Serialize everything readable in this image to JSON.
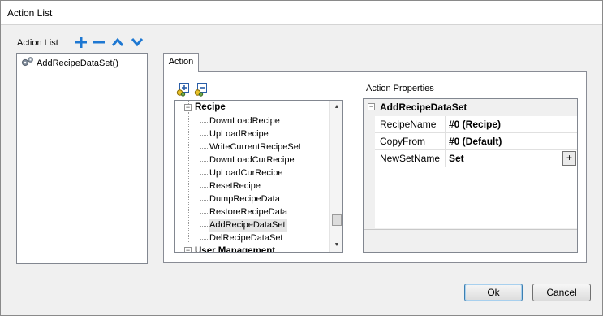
{
  "window": {
    "title": "Action List"
  },
  "action_list": {
    "label": "Action List",
    "toolbar": [
      {
        "name": "add-icon",
        "glyph": "+"
      },
      {
        "name": "remove-icon",
        "glyph": "−"
      },
      {
        "name": "move-up-icon",
        "glyph": "chevron-up"
      },
      {
        "name": "move-down-icon",
        "glyph": "chevron-down"
      }
    ],
    "items": [
      {
        "label": "AddRecipeDataSet()",
        "icon": "gear-icon"
      }
    ]
  },
  "tabs": [
    {
      "label": "Action",
      "active": true
    }
  ],
  "tree": {
    "groups": [
      {
        "label": "Recipe",
        "expanded": true,
        "items": [
          "DownLoadRecipe",
          "UpLoadRecipe",
          "WriteCurrentRecipeSet",
          "DownLoadCurRecipe",
          "UpLoadCurRecipe",
          "ResetRecipe",
          "DumpRecipeData",
          "RestoreRecipeData",
          "AddRecipeDataSet",
          "DelRecipeDataSet"
        ],
        "selected": "AddRecipeDataSet"
      },
      {
        "label": "User Management",
        "expanded": true
      }
    ],
    "expand_glyph": "−"
  },
  "properties": {
    "label": "Action Properties",
    "category": "AddRecipeDataSet",
    "rows": [
      {
        "name": "RecipeName",
        "value": "#0 (Recipe)"
      },
      {
        "name": "CopyFrom",
        "value": "#0 (Default)"
      },
      {
        "name": "NewSetName",
        "value": "Set",
        "button": "+"
      }
    ]
  },
  "buttons": {
    "ok": "Ok",
    "cancel": "Cancel"
  },
  "colors": {
    "accent": "#1e78d2",
    "default_button_border": "#3c7fb1"
  }
}
